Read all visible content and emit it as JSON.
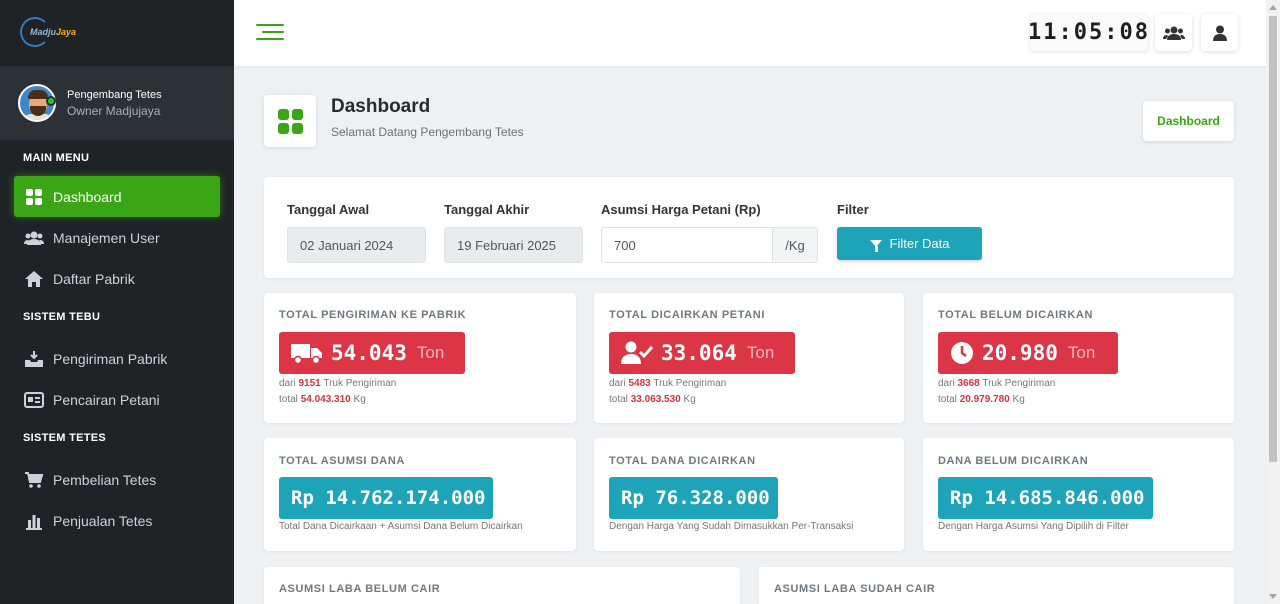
{
  "brand": {
    "logo_text_1": "Madju",
    "logo_text_2": "Jaya"
  },
  "user": {
    "name": "Pengembang Tetes",
    "role": "Owner Madjujaya"
  },
  "sidebar": {
    "sections": [
      {
        "title": "MAIN MENU",
        "items": [
          {
            "label": "Dashboard",
            "icon": "grid-icon"
          },
          {
            "label": "Manajemen User",
            "icon": "users-icon"
          },
          {
            "label": "Daftar Pabrik",
            "icon": "home-icon"
          }
        ]
      },
      {
        "title": "SISTEM TEBU",
        "items": [
          {
            "label": "Pengiriman Pabrik",
            "icon": "inbox-download-icon"
          },
          {
            "label": "Pencairan Petani",
            "icon": "id-card-icon"
          }
        ]
      },
      {
        "title": "SISTEM TETES",
        "items": [
          {
            "label": "Pembelian Tetes",
            "icon": "cart-icon"
          },
          {
            "label": "Penjualan Tetes",
            "icon": "bar-chart-icon"
          }
        ]
      }
    ]
  },
  "topbar": {
    "clock": "11:05:08"
  },
  "header": {
    "title": "Dashboard",
    "subtitle": "Selamat Datang Pengembang Tetes",
    "breadcrumb": "Dashboard"
  },
  "filter": {
    "start_label": "Tanggal Awal",
    "start_value": "02 Januari 2024",
    "end_label": "Tanggal Akhir",
    "end_value": "19 Februari 2025",
    "price_label": "Asumsi Harga Petani (Rp)",
    "price_value": "700",
    "price_unit": "/Kg",
    "filter_label": "Filter",
    "filter_button": "Filter Data"
  },
  "stats": {
    "pengiriman": {
      "title": "TOTAL PENGIRIMAN KE PABRIK",
      "value": "54.043",
      "unit": "Ton",
      "line1_pre": "dari",
      "line1_val": "9151",
      "line1_post": "Truk Pengiriman",
      "line2_pre": "total",
      "line2_val": "54.043.310",
      "line2_post": "Kg"
    },
    "dicairkan": {
      "title": "TOTAL DICAIRKAN PETANI",
      "value": "33.064",
      "unit": "Ton",
      "line1_pre": "dari",
      "line1_val": "5483",
      "line1_post": "Truk Pengiriman",
      "line2_pre": "total",
      "line2_val": "33.063.530",
      "line2_post": "Kg"
    },
    "belum": {
      "title": "TOTAL BELUM DICAIRKAN",
      "value": "20.980",
      "unit": "Ton",
      "line1_pre": "dari",
      "line1_val": "3668",
      "line1_post": "Truk Pengiriman",
      "line2_pre": "total",
      "line2_val": "20.979.780",
      "line2_post": "Kg"
    },
    "asumsi_dana": {
      "title": "TOTAL ASUMSI DANA",
      "value": "Rp 14.762.174.000",
      "note": "Total Dana Dicairkaan + Asumsi Dana Belum Dicairkan"
    },
    "dana_dicairkan": {
      "title": "TOTAL DANA DICAIRKAN",
      "value": "Rp 76.328.000",
      "note": "Dengan Harga Yang Sudah Dimasukkan Per-Transaksi"
    },
    "dana_belum": {
      "title": "DANA BELUM DICAIRKAN",
      "value": "Rp 14.685.846.000",
      "note": "Dengan Harga Asumsi Yang Dipilih di Filter"
    },
    "laba_belum": {
      "title": "ASUMSI LABA BELUM CAIR"
    },
    "laba_sudah": {
      "title": "ASUMSI LABA SUDAH CAIR"
    }
  },
  "colors": {
    "accent": "#3aa615",
    "danger": "#dc3545",
    "info": "#1ea4b8",
    "sidebar": "#1f2326"
  }
}
